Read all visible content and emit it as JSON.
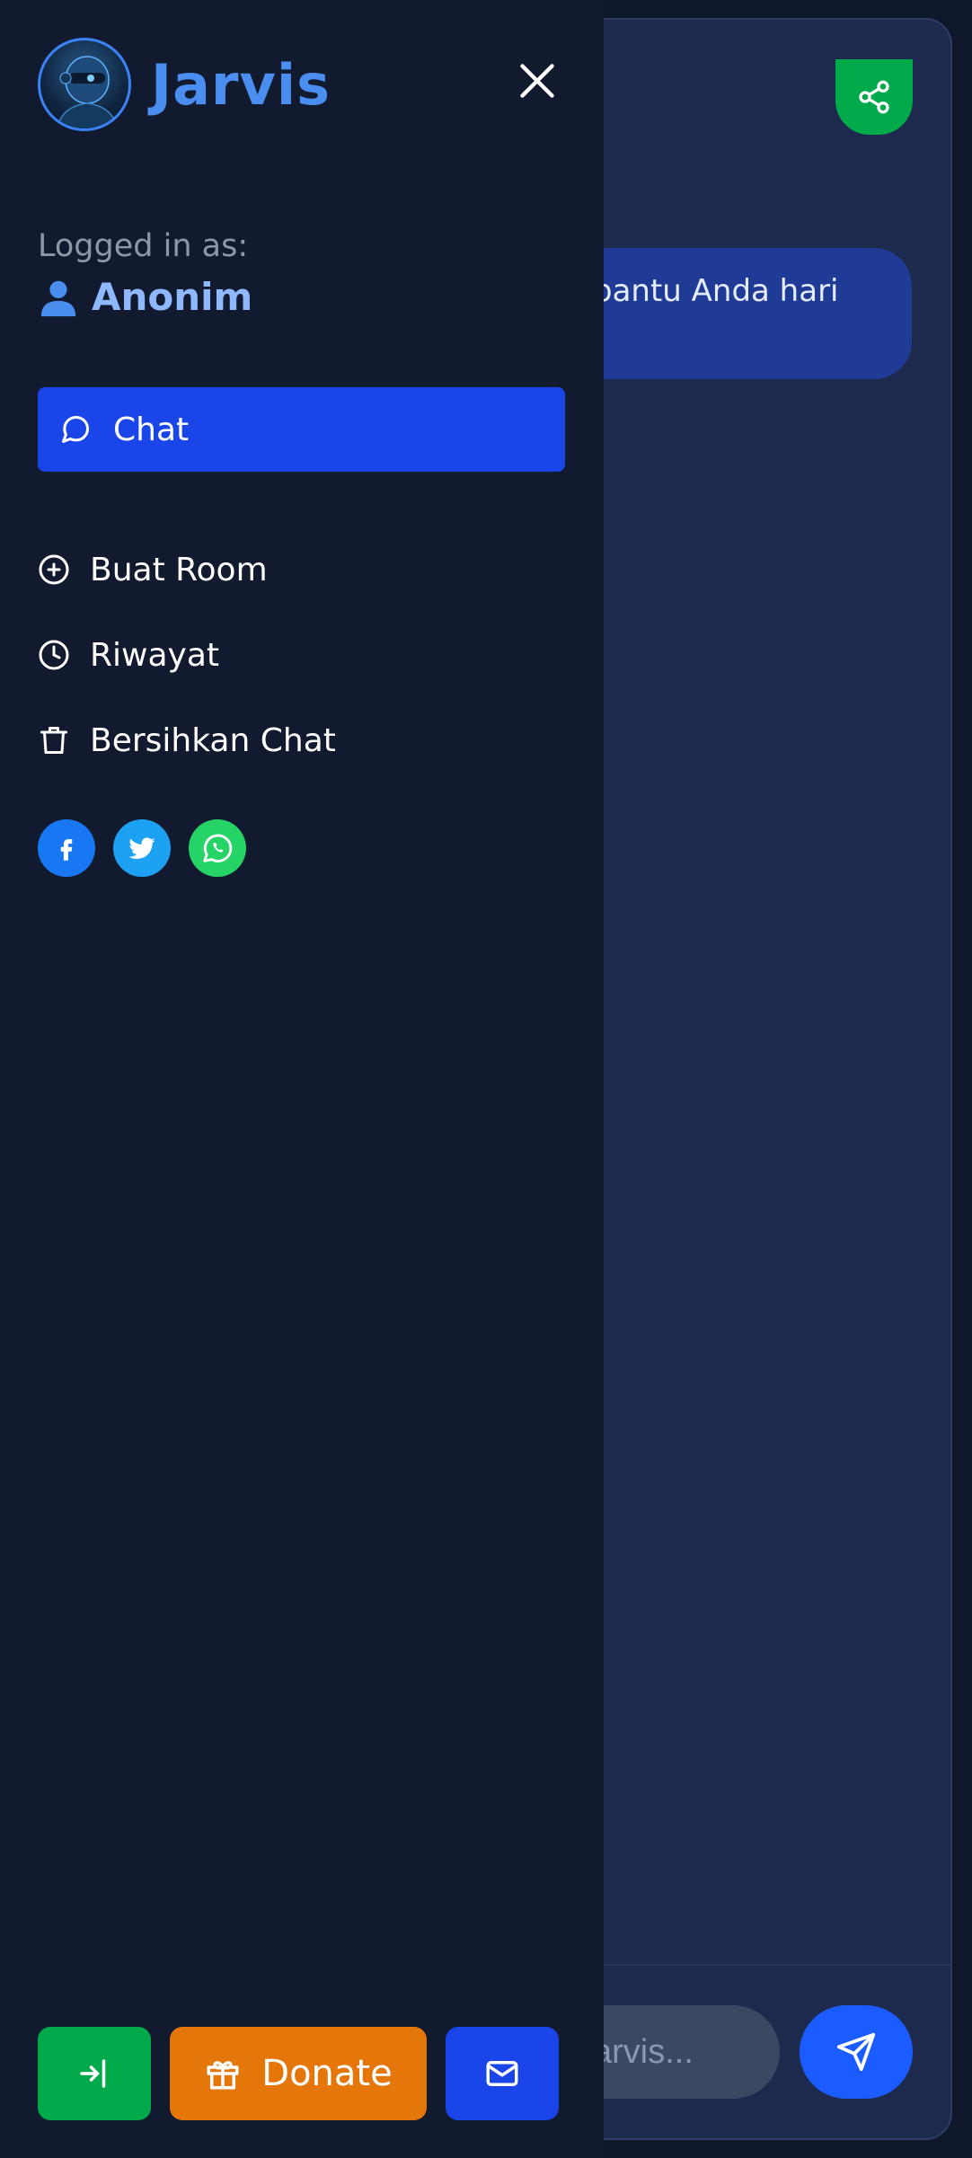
{
  "app": {
    "title": "Jarvis"
  },
  "session": {
    "logged_in_label": "Logged in as:",
    "user_name": "Anonim"
  },
  "nav": {
    "active": {
      "label": "Chat",
      "icon": "chat-bubble-icon"
    },
    "items": [
      {
        "label": "Buat Room",
        "icon": "plus-circle-icon"
      },
      {
        "label": "Riwayat",
        "icon": "clock-icon"
      },
      {
        "label": "Bersihkan Chat",
        "icon": "trash-icon"
      }
    ]
  },
  "social": [
    {
      "name": "facebook",
      "icon": "facebook-icon",
      "color": "#1877f2"
    },
    {
      "name": "twitter",
      "icon": "twitter-icon",
      "color": "#1da1f2"
    },
    {
      "name": "whatsapp",
      "icon": "whatsapp-icon",
      "color": "#25d366"
    }
  ],
  "footer": {
    "donate_label": "Donate",
    "login_icon": "login-icon",
    "donate_icon": "gift-icon",
    "mail_icon": "mail-icon"
  },
  "chat": {
    "visible_message": "pantu Anda hari",
    "input_placeholder": "arvis...",
    "share_icon": "share-icon",
    "send_icon": "send-icon"
  },
  "colors": {
    "drawer_bg": "#111a2e",
    "active_nav": "#1a45e8",
    "brand": "#4a8ef0",
    "login": "#00a94a",
    "donate": "#e5760a",
    "share": "#00a94a",
    "send": "#1a5cff"
  }
}
